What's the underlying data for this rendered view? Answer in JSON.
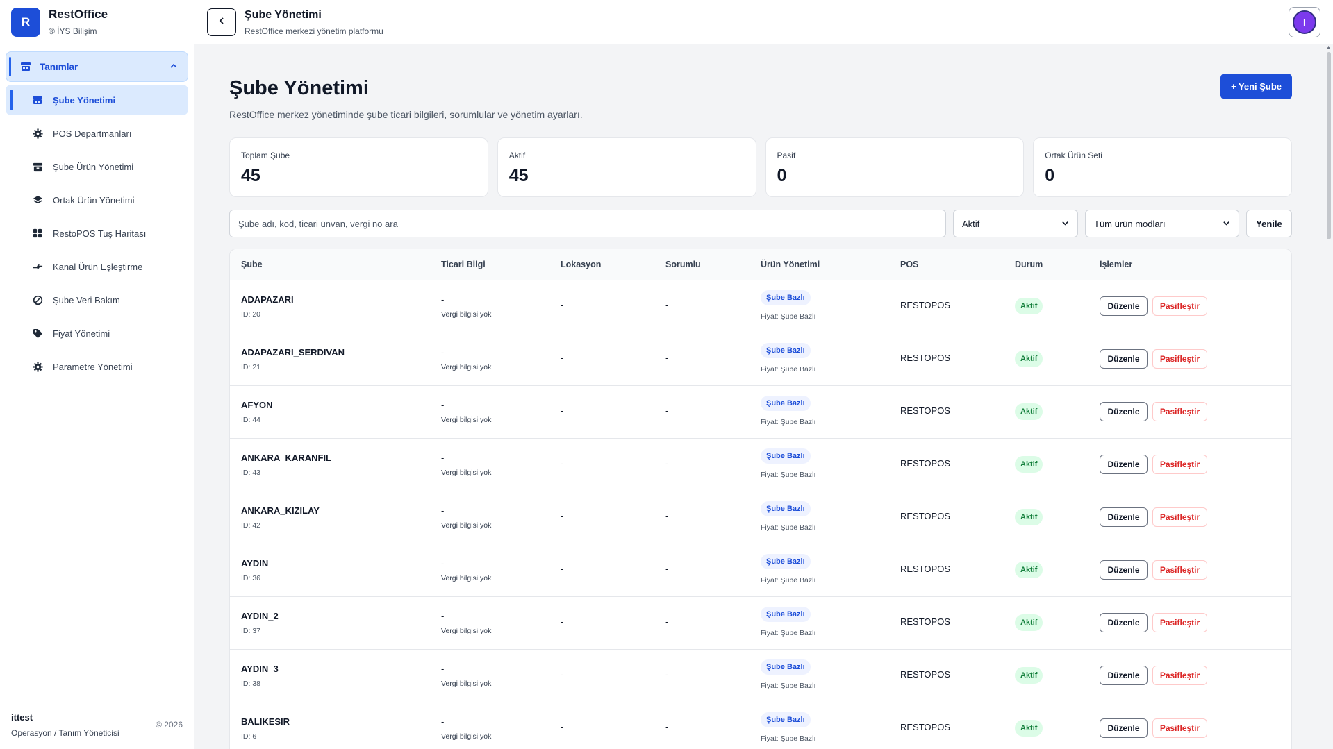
{
  "brand": {
    "logo_letter": "R",
    "name": "RestOffice",
    "subtitle": "® İYS Bilişim"
  },
  "sidebar": {
    "group": {
      "label": "Tanımlar",
      "icon": "store-icon"
    },
    "items": [
      {
        "label": "Şube Yönetimi",
        "icon": "store-icon",
        "active": true
      },
      {
        "label": "POS Departmanları",
        "icon": "gear-icon"
      },
      {
        "label": "Şube Ürün Yönetimi",
        "icon": "archive-icon"
      },
      {
        "label": "Ortak Ürün Yönetimi",
        "icon": "layers-icon"
      },
      {
        "label": "RestoPOS Tuş Haritası",
        "icon": "grid-icon"
      },
      {
        "label": "Kanal Ürün Eşleştirme",
        "icon": "swap-icon"
      },
      {
        "label": "Şube Veri Bakım",
        "icon": "block-icon"
      },
      {
        "label": "Fiyat Yönetimi",
        "icon": "tag-icon"
      },
      {
        "label": "Parametre Yönetimi",
        "icon": "gear-icon"
      }
    ],
    "footer": {
      "user": "ittest",
      "role": "Operasyon / Tanım Yöneticisi",
      "copyright": "© 2026"
    }
  },
  "topbar": {
    "title": "Şube Yönetimi",
    "subtitle": "RestOffice merkezi yönetim platformu",
    "avatar_letter": "I"
  },
  "page": {
    "title": "Şube Yönetimi",
    "description": "RestOffice merkez yönetiminde şube ticari bilgileri, sorumlular ve yönetim ayarları.",
    "new_button": "+ Yeni Şube"
  },
  "stats": [
    {
      "label": "Toplam Şube",
      "value": "45"
    },
    {
      "label": "Aktif",
      "value": "45"
    },
    {
      "label": "Pasif",
      "value": "0"
    },
    {
      "label": "Ortak Ürün Seti",
      "value": "0"
    }
  ],
  "filters": {
    "search_placeholder": "Şube adı, kod, ticari ünvan, vergi no ara",
    "status_value": "Aktif",
    "mode_value": "Tüm ürün modları",
    "refresh_label": "Yenile"
  },
  "table": {
    "headers": [
      "Şube",
      "Ticari Bilgi",
      "Lokasyon",
      "Sorumlu",
      "Ürün Yönetimi",
      "POS",
      "Durum",
      "İşlemler"
    ],
    "rows": [
      {
        "name": "ADAPAZARI",
        "id": "ID: 20",
        "trade": "-",
        "trade_sub": "Vergi bilgisi yok",
        "location": "-",
        "responsible": "-",
        "mode": "Şube Bazlı",
        "price": "Fiyat: Şube Bazlı",
        "pos": "RESTOPOS",
        "status": "Aktif",
        "edit": "Düzenle",
        "deactivate": "Pasifleştir"
      },
      {
        "name": "ADAPAZARI_SERDIVAN",
        "id": "ID: 21",
        "trade": "-",
        "trade_sub": "Vergi bilgisi yok",
        "location": "-",
        "responsible": "-",
        "mode": "Şube Bazlı",
        "price": "Fiyat: Şube Bazlı",
        "pos": "RESTOPOS",
        "status": "Aktif",
        "edit": "Düzenle",
        "deactivate": "Pasifleştir"
      },
      {
        "name": "AFYON",
        "id": "ID: 44",
        "trade": "-",
        "trade_sub": "Vergi bilgisi yok",
        "location": "-",
        "responsible": "-",
        "mode": "Şube Bazlı",
        "price": "Fiyat: Şube Bazlı",
        "pos": "RESTOPOS",
        "status": "Aktif",
        "edit": "Düzenle",
        "deactivate": "Pasifleştir"
      },
      {
        "name": "ANKARA_KARANFIL",
        "id": "ID: 43",
        "trade": "-",
        "trade_sub": "Vergi bilgisi yok",
        "location": "-",
        "responsible": "-",
        "mode": "Şube Bazlı",
        "price": "Fiyat: Şube Bazlı",
        "pos": "RESTOPOS",
        "status": "Aktif",
        "edit": "Düzenle",
        "deactivate": "Pasifleştir"
      },
      {
        "name": "ANKARA_KIZILAY",
        "id": "ID: 42",
        "trade": "-",
        "trade_sub": "Vergi bilgisi yok",
        "location": "-",
        "responsible": "-",
        "mode": "Şube Bazlı",
        "price": "Fiyat: Şube Bazlı",
        "pos": "RESTOPOS",
        "status": "Aktif",
        "edit": "Düzenle",
        "deactivate": "Pasifleştir"
      },
      {
        "name": "AYDIN",
        "id": "ID: 36",
        "trade": "-",
        "trade_sub": "Vergi bilgisi yok",
        "location": "-",
        "responsible": "-",
        "mode": "Şube Bazlı",
        "price": "Fiyat: Şube Bazlı",
        "pos": "RESTOPOS",
        "status": "Aktif",
        "edit": "Düzenle",
        "deactivate": "Pasifleştir"
      },
      {
        "name": "AYDIN_2",
        "id": "ID: 37",
        "trade": "-",
        "trade_sub": "Vergi bilgisi yok",
        "location": "-",
        "responsible": "-",
        "mode": "Şube Bazlı",
        "price": "Fiyat: Şube Bazlı",
        "pos": "RESTOPOS",
        "status": "Aktif",
        "edit": "Düzenle",
        "deactivate": "Pasifleştir"
      },
      {
        "name": "AYDIN_3",
        "id": "ID: 38",
        "trade": "-",
        "trade_sub": "Vergi bilgisi yok",
        "location": "-",
        "responsible": "-",
        "mode": "Şube Bazlı",
        "price": "Fiyat: Şube Bazlı",
        "pos": "RESTOPOS",
        "status": "Aktif",
        "edit": "Düzenle",
        "deactivate": "Pasifleştir"
      },
      {
        "name": "BALIKESIR",
        "id": "ID: 6",
        "trade": "-",
        "trade_sub": "Vergi bilgisi yok",
        "location": "-",
        "responsible": "-",
        "mode": "Şube Bazlı",
        "price": "Fiyat: Şube Bazlı",
        "pos": "RESTOPOS",
        "status": "Aktif",
        "edit": "Düzenle",
        "deactivate": "Pasifleştir"
      }
    ]
  },
  "colors": {
    "accent": "#1d4ed8",
    "accent_light": "#dbeafe",
    "status_active_bg": "#dcfce7",
    "status_active_text": "#15803d",
    "danger": "#dc2626"
  }
}
